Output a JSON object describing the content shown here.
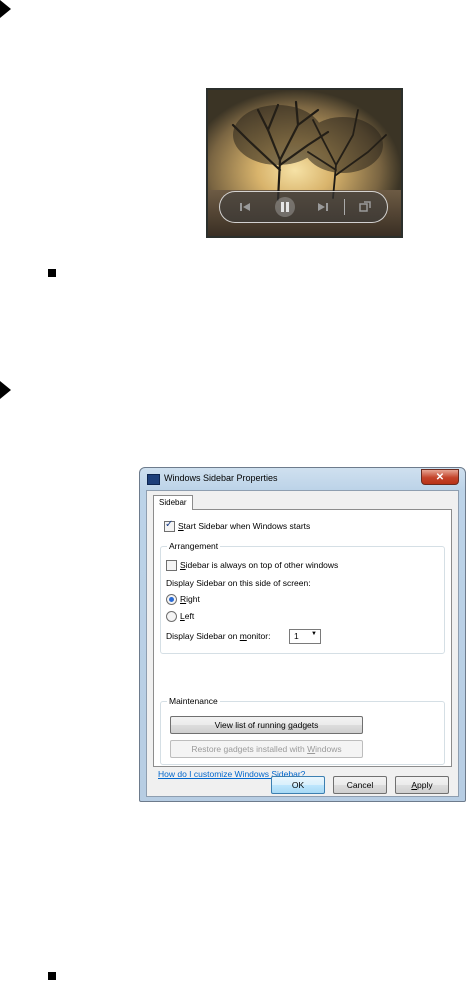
{
  "slideshow": {
    "controls": [
      "previous-icon",
      "pause-icon",
      "next-icon",
      "view-icon"
    ]
  },
  "dialog": {
    "title": "Windows Sidebar Properties",
    "close_label": "✕",
    "tab_label": "Sidebar",
    "start_sidebar": {
      "pre": "",
      "mnemonic": "S",
      "post": "tart Sidebar when Windows starts",
      "checked": true
    },
    "arrangement": {
      "title": "Arrangement",
      "always_on_top": {
        "pre": "",
        "mnemonic": "S",
        "post": "idebar is always on top of other windows",
        "checked": false
      },
      "side_label": "Display Sidebar on this side of screen:",
      "right": {
        "pre": "",
        "mnemonic": "R",
        "post": "ight",
        "selected": true
      },
      "left": {
        "pre": "",
        "mnemonic": "L",
        "post": "eft",
        "selected": false
      },
      "monitor": {
        "pre": "Display Sidebar on ",
        "mnemonic": "m",
        "post": "onitor:"
      },
      "monitor_value": "1"
    },
    "maintenance": {
      "title": "Maintenance",
      "view_list": {
        "pre": "View list of running ",
        "mnemonic": "g",
        "post": "adgets"
      },
      "restore": {
        "pre": "Restore gadgets installed with ",
        "mnemonic": "W",
        "post": "indows"
      }
    },
    "help_link": "How do I customize Windows Sidebar?",
    "ok": "OK",
    "cancel": "Cancel",
    "apply": {
      "pre": "",
      "mnemonic": "A",
      "post": "pply"
    }
  }
}
